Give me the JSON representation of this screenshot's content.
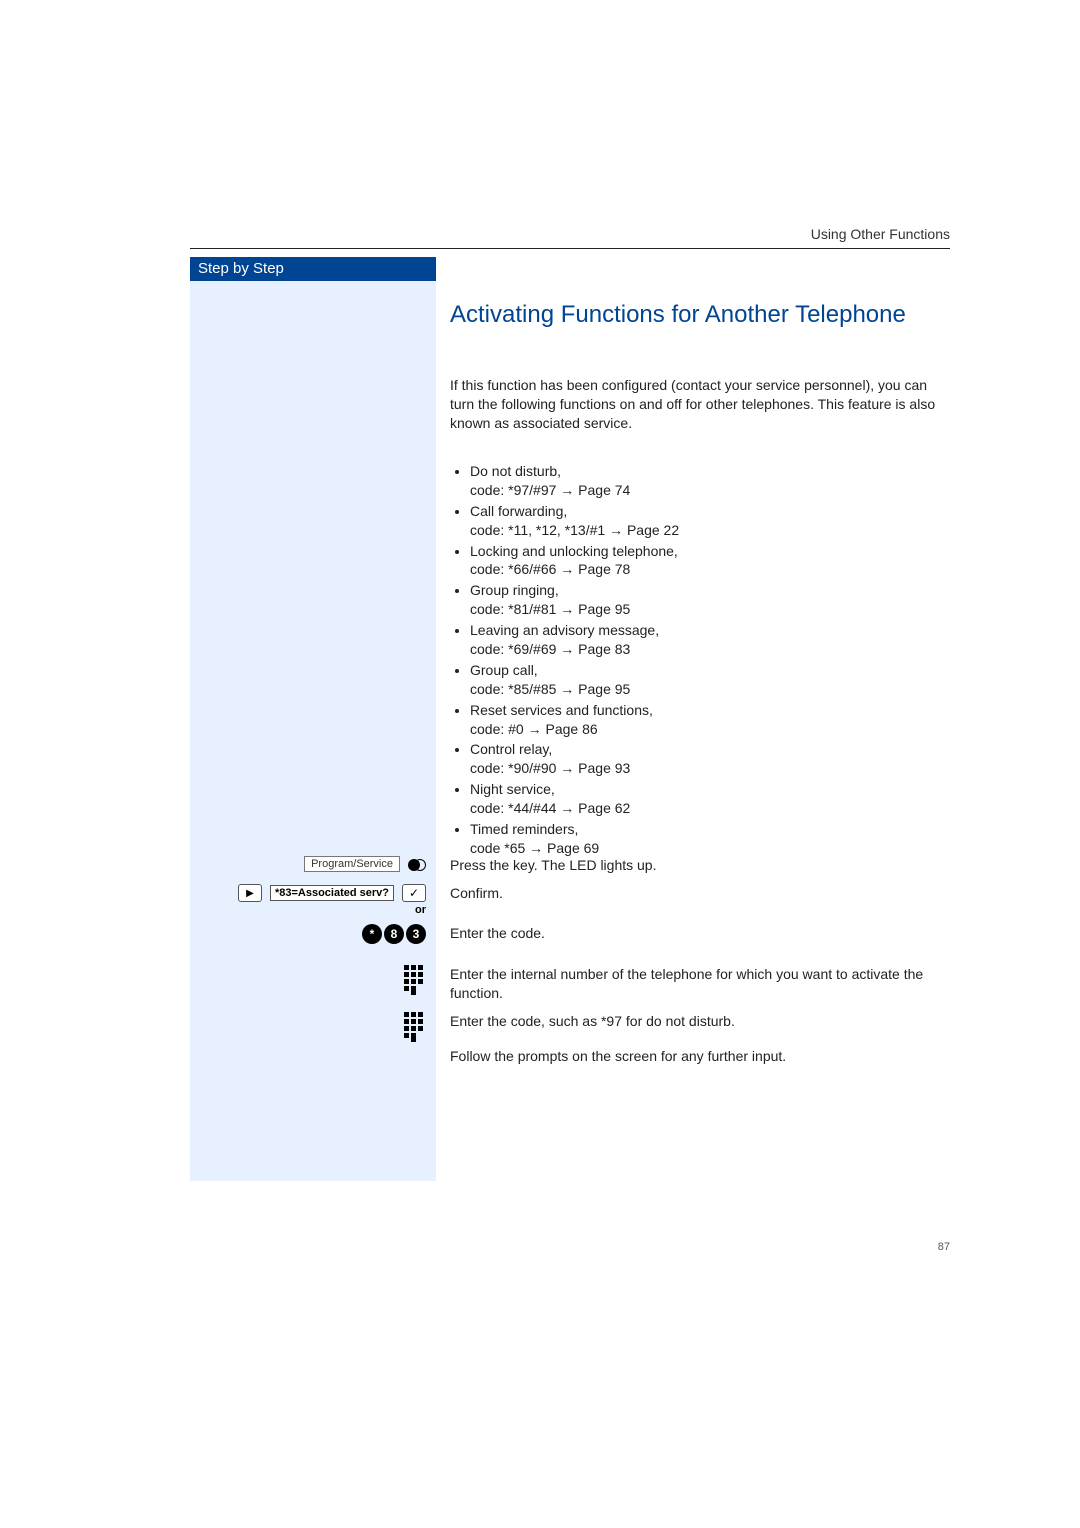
{
  "header": {
    "section": "Using Other Functions"
  },
  "sidebar": {
    "title": "Step by Step"
  },
  "main": {
    "title": "Activating Functions for Another Telephone",
    "intro": "If this function has been configured (contact your service personnel), you can turn the following functions on and off for other telephones. This feature is also known as associated service.",
    "items": [
      {
        "label": "Do not disturb,",
        "code": "code: *97/#97 → Page 74"
      },
      {
        "label": "Call forwarding,",
        "code": "code: *11, *12, *13/#1 → Page 22"
      },
      {
        "label": "Locking and unlocking telephone,",
        "code": "code: *66/#66 → Page 78"
      },
      {
        "label": "Group ringing,",
        "code": "code: *81/#81 → Page 95"
      },
      {
        "label": "Leaving an advisory message,",
        "code": "code: *69/#69 → Page 83"
      },
      {
        "label": "Group call,",
        "code": "code: *85/#85 → Page 95"
      },
      {
        "label": "Reset services and functions,",
        "code": "code: #0 → Page 86"
      },
      {
        "label": "Control relay,",
        "code": "code: *90/#90 → Page 93"
      },
      {
        "label": "Night service,",
        "code": "code: *44/#44 → Page 62"
      },
      {
        "label": "Timed reminders,",
        "code": "code *65 → Page 69"
      }
    ]
  },
  "steps": {
    "program_key": "Program/Service",
    "press_key": "Press the key. The LED lights up.",
    "display_prompt": "*83=Associated serv?",
    "confirm": "Confirm.",
    "or": "or",
    "code_keys": [
      "*",
      "8",
      "3"
    ],
    "enter_code": "Enter the code.",
    "enter_internal": "Enter the internal number of the telephone for which you want to activate the function.",
    "enter_func_code": "Enter the code, such as *97 for do not disturb.",
    "follow_prompts": "Follow the prompts on the screen for any further input."
  },
  "footer": {
    "page": "87"
  }
}
